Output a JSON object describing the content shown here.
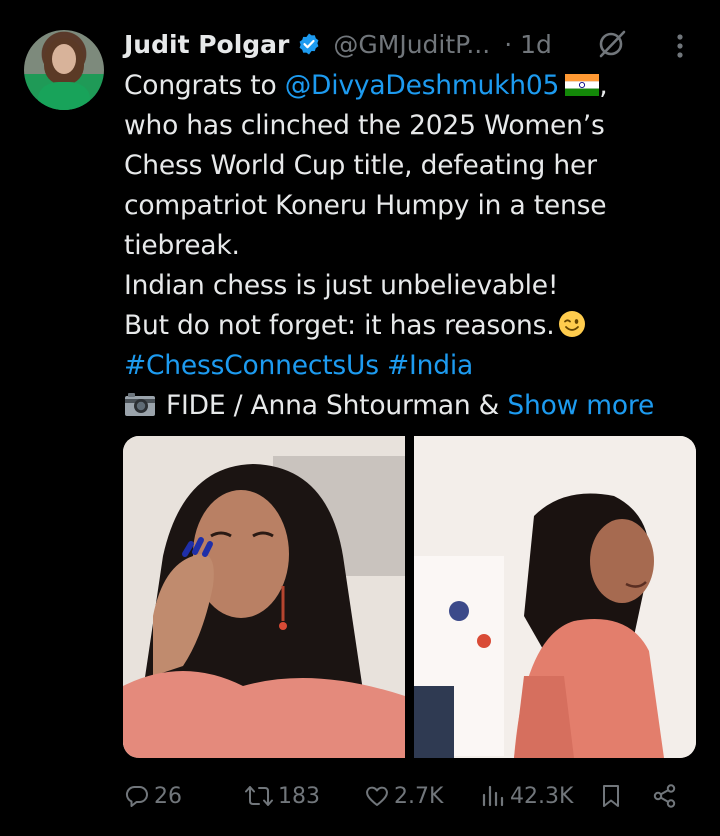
{
  "tweet": {
    "author_name": "Judit Polgar",
    "handle": "@GMJuditP...",
    "time": "· 1d",
    "lines": {
      "l1_prefix": "Congrats to ",
      "l1_mention": "@DivyaDeshmukh05",
      "l1_suffix": ",",
      "l2": "who has clinched the 2025 Women’s",
      "l3": "Chess World Cup title, defeating her",
      "l4": "compatriot Koneru Humpy in a tense",
      "l5": "tiebreak.",
      "l6": "Indian chess is just unbelievable!",
      "l7": "But do not forget: it has reasons.",
      "hashtag1": "#ChessConnectsUs",
      "hashtag2": "#India",
      "credit": "FIDE / Anna Shtourman & ",
      "show_more": "Show more"
    }
  },
  "actions": {
    "replies": "26",
    "reposts": "183",
    "likes": "2.7K",
    "views": "42.3K"
  },
  "icons": {
    "verified": "verified-badge-icon",
    "grok": "grok-icon",
    "more": "more-vertical-icon",
    "reply": "reply-icon",
    "repost": "repost-icon",
    "like": "heart-icon",
    "views": "views-icon",
    "bookmark": "bookmark-icon",
    "share": "share-icon"
  },
  "colors": {
    "accent": "#1d9bf0",
    "muted": "#71767b",
    "text": "#e7e9ea",
    "background": "#000000"
  }
}
